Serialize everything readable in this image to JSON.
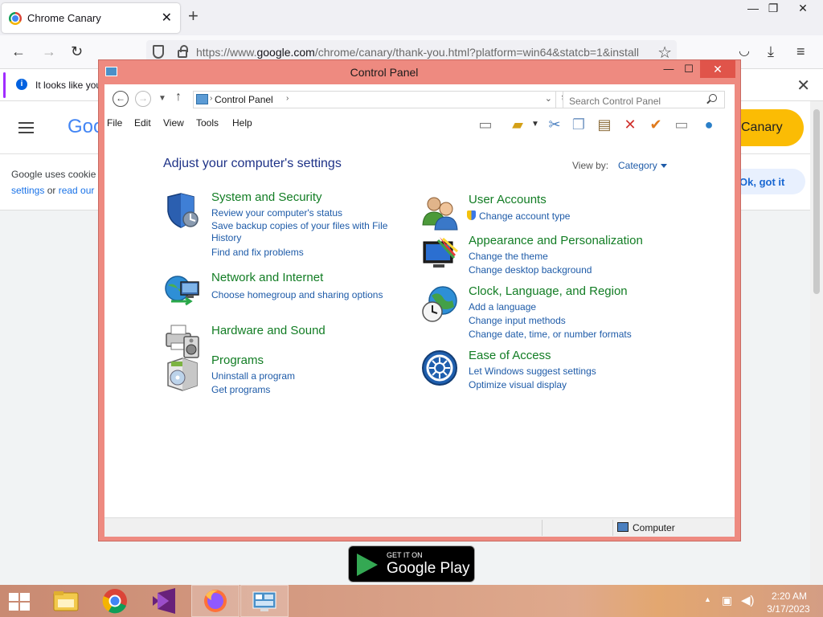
{
  "browser": {
    "tab_title": "Chrome Canary",
    "url_prefix": "https://www.",
    "url_domain": "google.com",
    "url_rest": "/chrome/canary/thank-you.html?platform=win64&statcb=1&install",
    "infobar_text": "It looks like you"
  },
  "page": {
    "logo_fragment": "Goo",
    "canary_button": "Canary",
    "cookie_line1": "Google uses cookie",
    "cookie_settings": "settings",
    "cookie_or": " or ",
    "cookie_read": "read our",
    "ok_button": "Ok, got it",
    "gplay_get": "GET IT ON",
    "gplay_store": "Google Play"
  },
  "control_panel": {
    "window_title": "Control Panel",
    "breadcrumb": "Control Panel",
    "search_placeholder": "Search Control Panel",
    "menu": [
      "File",
      "Edit",
      "View",
      "Tools",
      "Help"
    ],
    "heading": "Adjust your computer's settings",
    "view_by_label": "View by:",
    "view_by_value": "Category",
    "categories": {
      "system_security": {
        "title": "System and Security",
        "links": [
          "Review your computer's status",
          "Save backup copies of your files with File History",
          "Find and fix problems"
        ]
      },
      "network": {
        "title": "Network and Internet",
        "links": [
          "Choose homegroup and sharing options"
        ]
      },
      "hardware": {
        "title": "Hardware and Sound",
        "links": []
      },
      "programs": {
        "title": "Programs",
        "links": [
          "Uninstall a program",
          "Get programs"
        ]
      },
      "user_accounts": {
        "title": "User Accounts",
        "links": [
          "Change account type"
        ]
      },
      "appearance": {
        "title": "Appearance and Personalization",
        "links": [
          "Change the theme",
          "Change desktop background"
        ]
      },
      "clock": {
        "title": "Clock, Language, and Region",
        "links": [
          "Add a language",
          "Change input methods",
          "Change date, time, or number formats"
        ]
      },
      "ease": {
        "title": "Ease of Access",
        "links": [
          "Let Windows suggest settings",
          "Optimize visual display"
        ]
      }
    },
    "status_location": "Computer"
  },
  "taskbar": {
    "time": "2:20 AM",
    "date": "3/17/2023"
  }
}
